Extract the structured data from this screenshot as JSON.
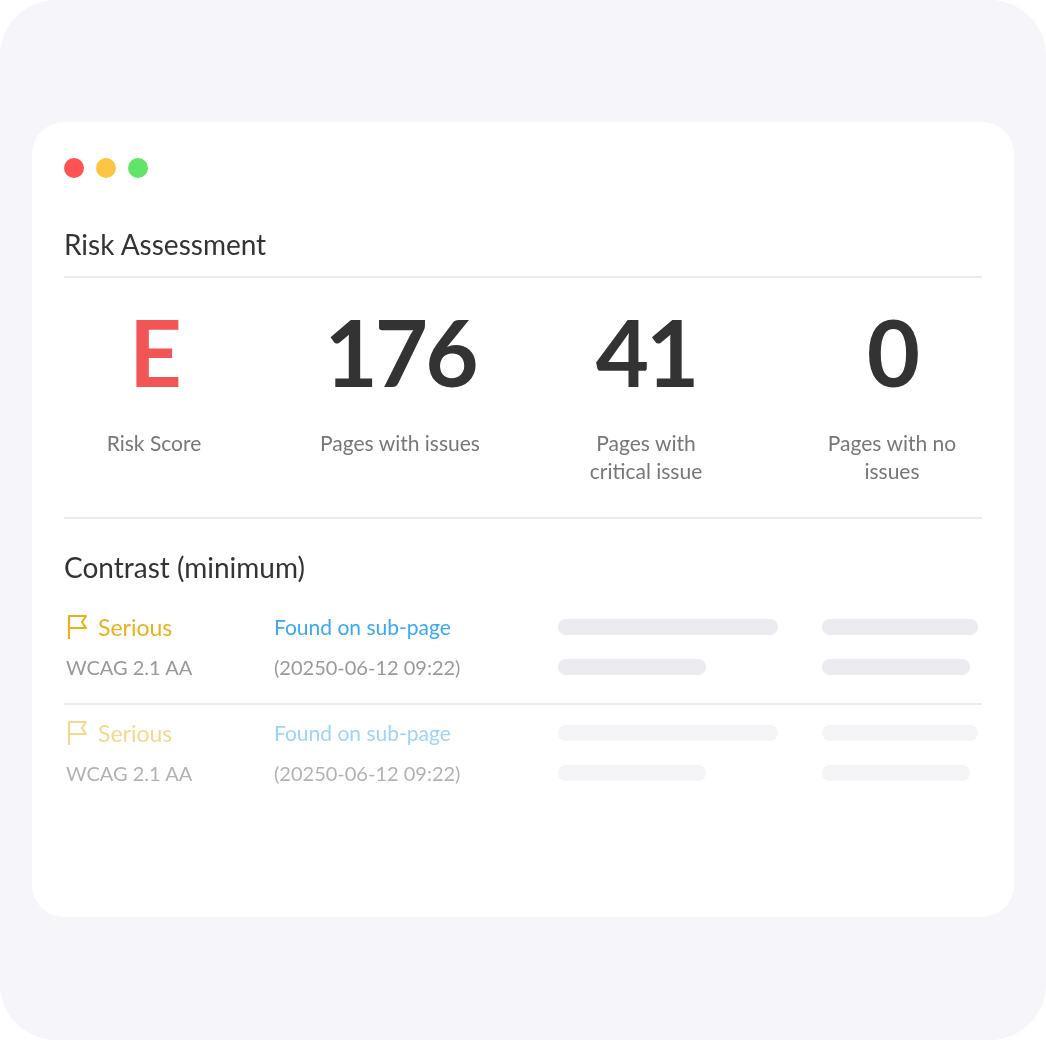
{
  "window": {
    "controls": [
      {
        "kind": "close"
      },
      {
        "kind": "minimize"
      },
      {
        "kind": "maximize"
      }
    ]
  },
  "title": "Risk Assessment",
  "stats": [
    {
      "kind": "grade",
      "value": "E",
      "label": "Risk Score"
    },
    {
      "kind": "count",
      "value": "176",
      "label": "Pages with issues"
    },
    {
      "kind": "count",
      "value": "41",
      "label": "Pages with critical issue"
    },
    {
      "kind": "count",
      "value": "0",
      "label": "Pages with no issues"
    }
  ],
  "section": {
    "title": "Contrast (minimum)",
    "issues": [
      {
        "severity": "Serious",
        "standard": "WCAG 2.1 AA",
        "link": "Found on sub-page",
        "date": "(20250-06-12 09:22)",
        "faded": false
      },
      {
        "severity": "Serious",
        "standard": "WCAG 2.1 AA",
        "link": "Found on sub-page",
        "date": "(20250-06-12 09:22)",
        "faded": true
      }
    ]
  }
}
